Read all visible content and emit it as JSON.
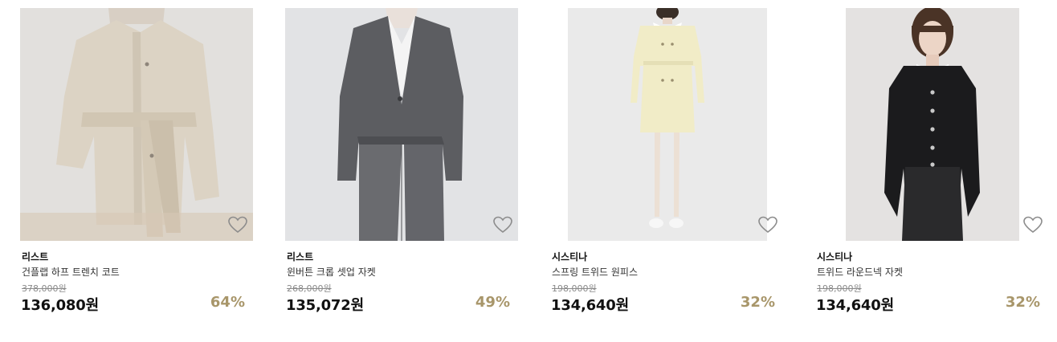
{
  "colors": {
    "discount": "#a8966a",
    "photo_bg_1": "#e6e5e3",
    "photo_bg_2": "#e2e3e5",
    "photo_bg_3": "#eaeaea",
    "photo_bg_4": "#e4e2e1",
    "heart_stroke": "#8c8c8c"
  },
  "products": [
    {
      "brand": "리스트",
      "name": "건플랩 하프 트렌치 코트",
      "original_price": "378,000원",
      "price": "136,080원",
      "discount": "64%",
      "image_icon": "beige-trench-coat-photo",
      "wishlist_icon": "heart-outline-icon"
    },
    {
      "brand": "리스트",
      "name": "윈버튼 크롭 셋업 자켓",
      "original_price": "268,000원",
      "price": "135,072원",
      "discount": "49%",
      "image_icon": "gray-cropped-jacket-photo",
      "wishlist_icon": "heart-outline-icon"
    },
    {
      "brand": "시스티나",
      "name": "스프링 트위드 원피스",
      "original_price": "198,000원",
      "price": "134,640원",
      "discount": "32%",
      "image_icon": "cream-tweed-dress-photo",
      "wishlist_icon": "heart-outline-icon"
    },
    {
      "brand": "시스티나",
      "name": "트위드 라운드넥 자켓",
      "original_price": "198,000원",
      "price": "134,640원",
      "discount": "32%",
      "image_icon": "black-tweed-jacket-photo",
      "wishlist_icon": "heart-outline-icon"
    }
  ]
}
